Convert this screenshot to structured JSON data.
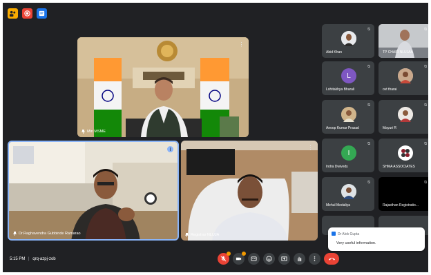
{
  "colors": {
    "background": "#202124",
    "tile": "#3c4043",
    "active_speaker_border": "#8ab4f8",
    "end_call": "#ea4335",
    "badge": "#f29900"
  },
  "top_icons": [
    {
      "icon": "people-icon",
      "color": "#f9ab00"
    },
    {
      "icon": "record-icon",
      "color": "#ea4335"
    },
    {
      "icon": "notes-icon",
      "color": "#1a73e8"
    }
  ],
  "main_tiles": {
    "top": {
      "name": "Min MSME"
    },
    "left": {
      "name": "Dr.Raghavendra Gubbinde Ramarao"
    },
    "right": {
      "name": "Registrar NLUJA"
    }
  },
  "grid": [
    {
      "name": "Abid Khan",
      "avatar_color": "#e8eaed",
      "initial": ""
    },
    {
      "name": "TP CHAIR NLUJAA",
      "avatar_color": "#cfd8dc",
      "initial": ""
    },
    {
      "name": "Lohitakhya Bharali",
      "avatar_color": "#7e57c2",
      "initial": "L"
    },
    {
      "name": "ovt tharai",
      "avatar_color": "#d7ccc8",
      "initial": ""
    },
    {
      "name": "Anoop Kumar Prasad",
      "avatar_color": "#a1887f",
      "initial": ""
    },
    {
      "name": "Mayuri R",
      "avatar_color": "#bcaaa4",
      "initial": ""
    },
    {
      "name": "Indra Dwivedy",
      "avatar_color": "#34a853",
      "initial": "I"
    },
    {
      "name": "SHMA ASSOCIATES",
      "avatar_color": "#ffffff",
      "initial": ""
    },
    {
      "name": "Mehul Medaliya",
      "avatar_color": "#90a4ae",
      "initial": ""
    },
    {
      "name": "Rajasthan Registratio...",
      "avatar_color": "",
      "initial": ""
    }
  ],
  "chat_popup": {
    "sender": "Dr Alok Gupta",
    "message": "Very useful information."
  },
  "bottom": {
    "time": "5:15 PM",
    "separator": "|",
    "meeting_code": "qrq-azpj-zob"
  },
  "controls": [
    "mic-off-icon",
    "camera-off-icon",
    "captions-icon",
    "emoji-icon",
    "present-icon",
    "raise-hand-icon",
    "more-icon",
    "end-call-icon"
  ]
}
